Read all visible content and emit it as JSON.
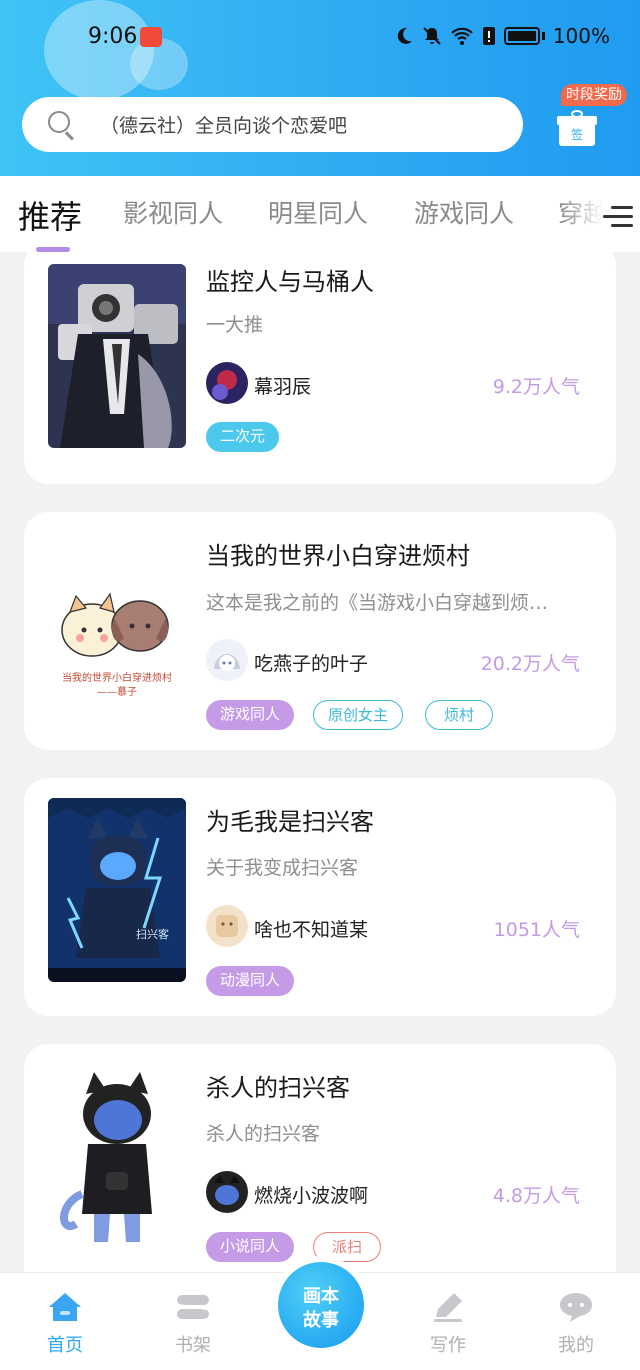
{
  "status_bar": {
    "time": "9:06",
    "battery": "100%",
    "icons": [
      "moon-icon",
      "bell-off-icon",
      "wifi-icon",
      "sim-alert-icon",
      "battery-icon"
    ]
  },
  "search": {
    "placeholder": "（德云社）全员向谈个恋爱吧"
  },
  "reward": {
    "badge": "时段奖励",
    "sign_label": "签"
  },
  "tabs": [
    {
      "label": "推荐",
      "active": true
    },
    {
      "label": "影视同人",
      "active": false
    },
    {
      "label": "明星同人",
      "active": false
    },
    {
      "label": "游戏同人",
      "active": false
    },
    {
      "label": "穿越",
      "active": false
    }
  ],
  "stories": [
    {
      "title": "监控人与马桶人",
      "desc": "一大推",
      "author": "幕羽辰",
      "popularity": "9.2万人气",
      "tags": [
        {
          "label": "二次元",
          "style": "filled-blue"
        }
      ]
    },
    {
      "title": "当我的世界小白穿进烦村",
      "desc": "这本是我之前的《当游戏小白穿越到烦…",
      "author": "吃燕子的叶子",
      "popularity": "20.2万人气",
      "tags": [
        {
          "label": "游戏同人",
          "style": "filled-purple"
        },
        {
          "label": "原创女主",
          "style": "outline-teal"
        },
        {
          "label": "烦村",
          "style": "outline-teal"
        }
      ],
      "cover_caption": "当我的世界小白穿进烦村\n——慕子"
    },
    {
      "title": "为毛我是扫兴客",
      "desc": "关于我变成扫兴客",
      "author": "啥也不知道某",
      "popularity": "1051人气",
      "tags": [
        {
          "label": "动漫同人",
          "style": "filled-purple"
        }
      ],
      "cover_caption": "扫兴客"
    },
    {
      "title": "杀人的扫兴客",
      "desc": "杀人的扫兴客",
      "author": "燃烧小波波啊",
      "popularity": "4.8万人气",
      "tags": [
        {
          "label": "小说同人",
          "style": "filled-purple"
        },
        {
          "label": "派扫",
          "style": "outline-red"
        }
      ]
    }
  ],
  "bottom_nav": {
    "items": [
      {
        "label": "首页",
        "icon": "home-icon",
        "active": true
      },
      {
        "label": "书架",
        "icon": "bookshelf-icon",
        "active": false
      },
      {
        "label": "写作",
        "icon": "pen-icon",
        "active": false
      },
      {
        "label": "我的",
        "icon": "chat-bubble-icon",
        "active": false
      }
    ],
    "center_label_line1": "画本",
    "center_label_line2": "故事"
  },
  "colors": {
    "header_blue": "#2faaf3",
    "tab_underline": "#b38be8",
    "popularity": "#c39ae6",
    "active_nav": "#2fa9f3"
  }
}
